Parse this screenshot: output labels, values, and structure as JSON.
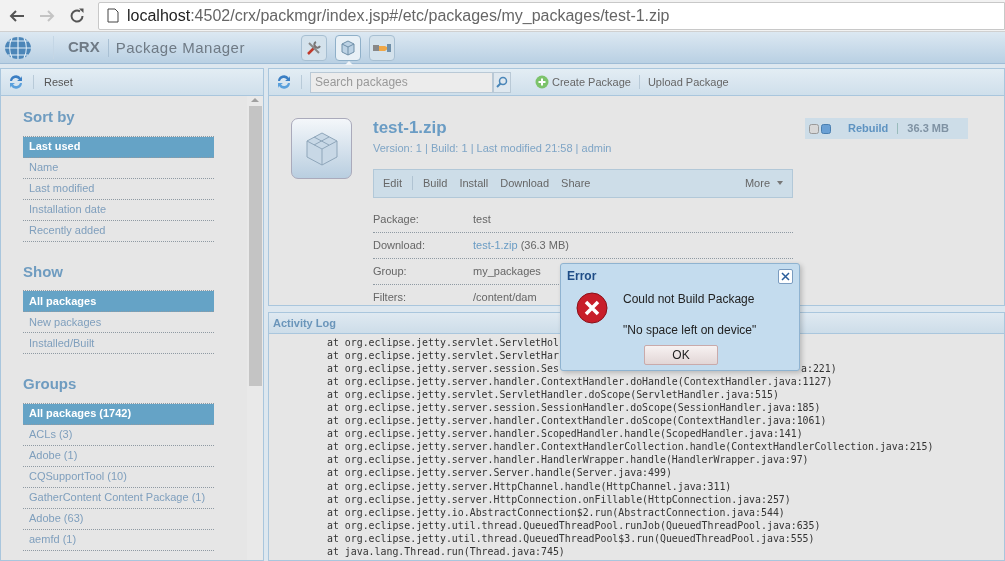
{
  "browser": {
    "url_host": "localhost",
    "url_path": ":4502/crx/packmgr/index.jsp#/etc/packages/my_packages/test-1.zip"
  },
  "app": {
    "logo_text": "CRX",
    "title": "Package Manager",
    "tools": [
      {
        "kind": "tools",
        "selected": false
      },
      {
        "kind": "packages",
        "selected": true
      },
      {
        "kind": "share",
        "selected": false
      }
    ]
  },
  "left_toolbar": {
    "reset": "Reset"
  },
  "sidebar": [
    {
      "heading": "Sort by",
      "items": [
        {
          "label": "Last used",
          "selected": true
        },
        {
          "label": "Name",
          "selected": false
        },
        {
          "label": "Last modified",
          "selected": false
        },
        {
          "label": "Installation date",
          "selected": false
        },
        {
          "label": "Recently added",
          "selected": false
        }
      ]
    },
    {
      "heading": "Show",
      "items": [
        {
          "label": "All packages",
          "selected": true
        },
        {
          "label": "New packages",
          "selected": false
        },
        {
          "label": "Installed/Built",
          "selected": false
        }
      ]
    },
    {
      "heading": "Groups",
      "items": [
        {
          "label": "All packages (1742)",
          "selected": true
        },
        {
          "label": "ACLs (3)",
          "selected": false
        },
        {
          "label": "Adobe (1)",
          "selected": false
        },
        {
          "label": "CQSupportTool (10)",
          "selected": false
        },
        {
          "label": "GatherContent Content Package (1)",
          "selected": false
        },
        {
          "label": "Adobe (63)",
          "selected": false
        },
        {
          "label": "aemfd (1)",
          "selected": false
        }
      ]
    }
  ],
  "right_toolbar": {
    "search_placeholder": "Search packages",
    "create": "Create Package",
    "upload": "Upload Package"
  },
  "package": {
    "name": "test-1.zip",
    "meta": "Version: 1 | Build: 1 | Last modified 21:58 | admin",
    "actions": [
      "Edit",
      "Build",
      "Install",
      "Download",
      "Share"
    ],
    "more": "More",
    "details": [
      {
        "label": "Package:",
        "value": "test",
        "kind": "text"
      },
      {
        "label": "Download:",
        "value": "test-1.zip",
        "suffix": "(36.3 MB)",
        "kind": "link"
      },
      {
        "label": "Group:",
        "value": "my_packages",
        "kind": "text"
      },
      {
        "label": "Filters:",
        "value": "/content/dam",
        "kind": "text"
      }
    ],
    "rebuild": "Rebuild",
    "size": "36.3 MB"
  },
  "activity_log": {
    "title": "Activity Log",
    "lines": [
      {
        "text": "at org.eclipse.jetty.servlet.ServletHol"
      },
      {
        "text": "at org.eclipse.jetty.servlet.ServletHar"
      },
      {
        "text": "at org.eclipse.jetty.server.session.Ses",
        "tail": "a:221)"
      },
      {
        "text": "at org.eclipse.jetty.server.handler.ContextHandler.doHandle(ContextHandler.java:1127)"
      },
      {
        "text": "at org.eclipse.jetty.servlet.ServletHandler.doScope(ServletHandler.java:515)"
      },
      {
        "text": "at org.eclipse.jetty.server.session.SessionHandler.doScope(SessionHandler.java:185)"
      },
      {
        "text": "at org.eclipse.jetty.server.handler.ContextHandler.doScope(ContextHandler.java:1061)"
      },
      {
        "text": "at org.eclipse.jetty.server.handler.ScopedHandler.handle(ScopedHandler.java:141)"
      },
      {
        "text": "at org.eclipse.jetty.server.handler.ContextHandlerCollection.handle(ContextHandlerCollection.java:215)"
      },
      {
        "text": "at org.eclipse.jetty.server.handler.HandlerWrapper.handle(HandlerWrapper.java:97)"
      },
      {
        "text": "at org.eclipse.jetty.server.Server.handle(Server.java:499)"
      },
      {
        "text": "at org.eclipse.jetty.server.HttpChannel.handle(HttpChannel.java:311)"
      },
      {
        "text": "at org.eclipse.jetty.server.HttpConnection.onFillable(HttpConnection.java:257)"
      },
      {
        "text": "at org.eclipse.jetty.io.AbstractConnection$2.run(AbstractConnection.java:544)"
      },
      {
        "text": "at org.eclipse.jetty.util.thread.QueuedThreadPool.runJob(QueuedThreadPool.java:635)"
      },
      {
        "text": "at org.eclipse.jetty.util.thread.QueuedThreadPool$3.run(QueuedThreadPool.java:555)"
      },
      {
        "text": "at java.lang.Thread.run(Thread.java:745)"
      }
    ]
  },
  "dialog": {
    "title": "Error",
    "message": "Could not Build Package",
    "detail": "\"No space left on device\"",
    "ok": "OK"
  }
}
